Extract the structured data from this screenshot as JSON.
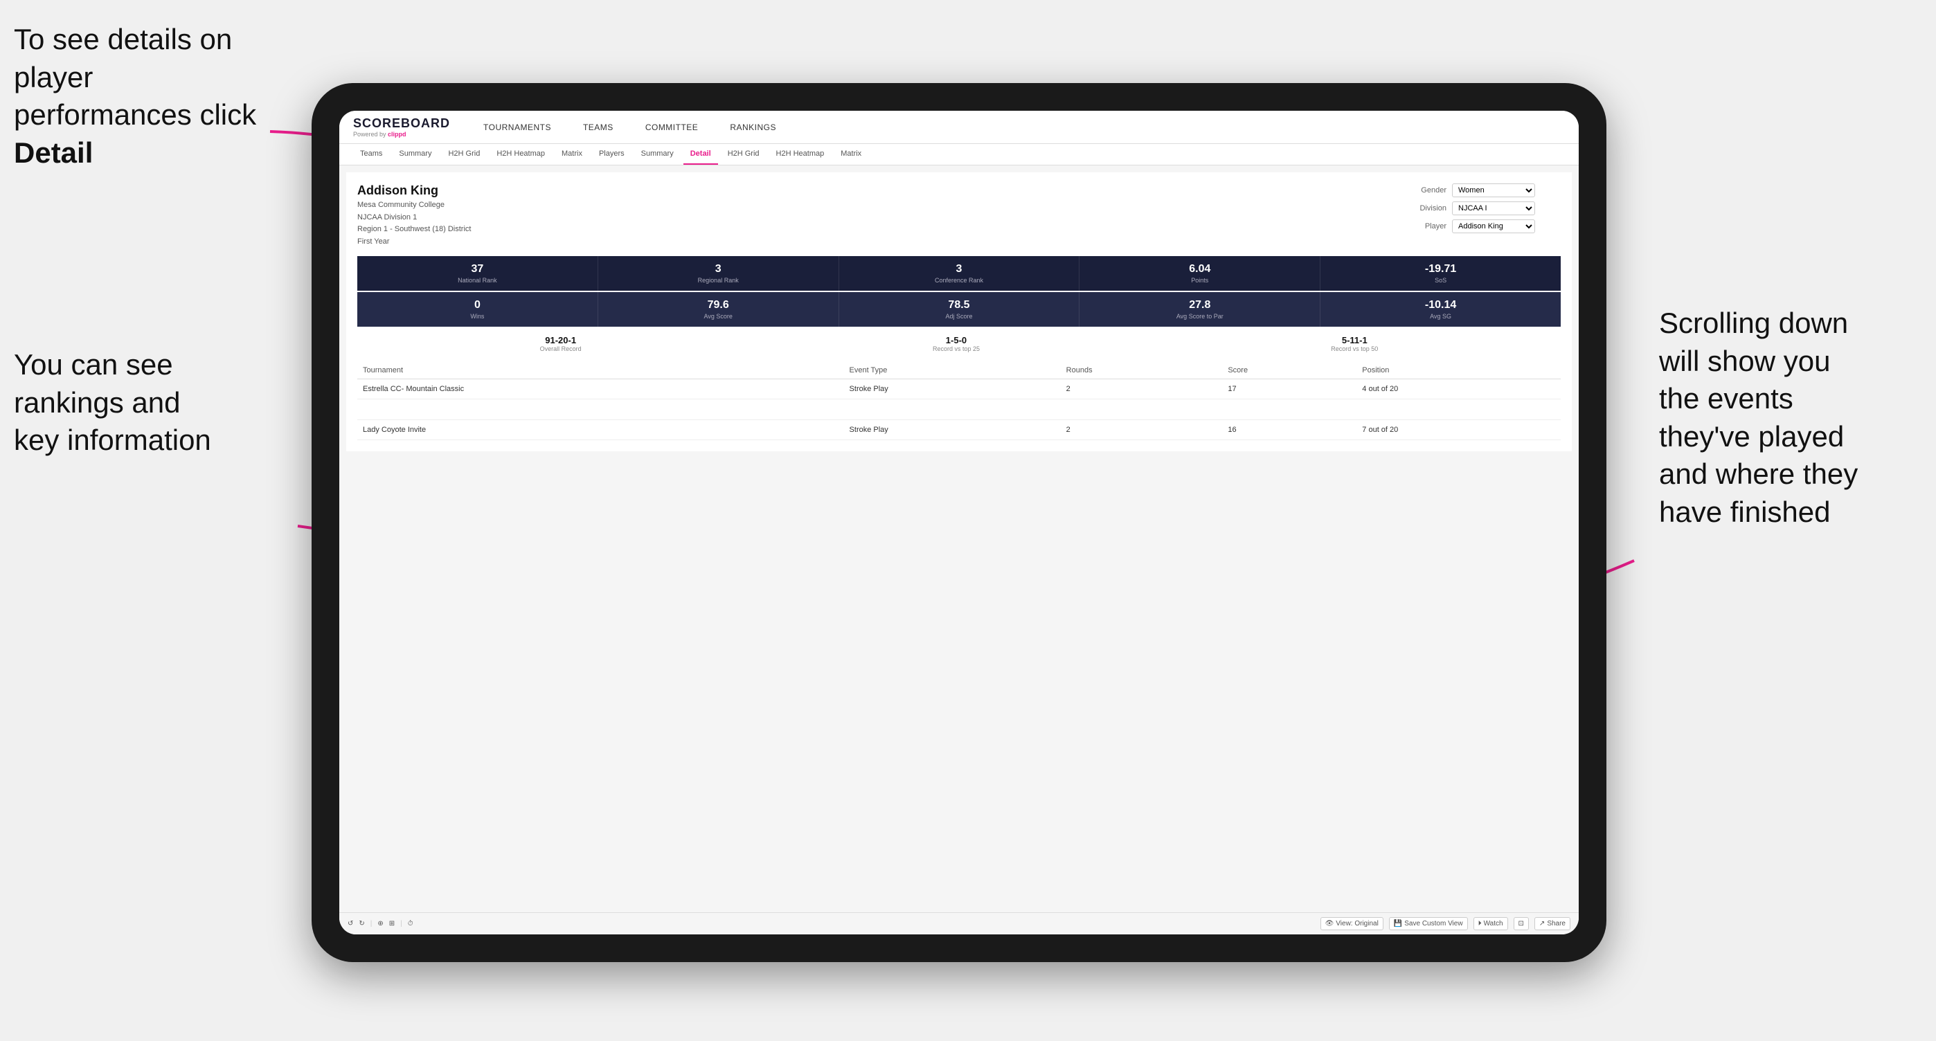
{
  "annotations": {
    "topleft": "To see details on player performances click ",
    "topleft_bold": "Detail",
    "bottomleft_line1": "You can see",
    "bottomleft_line2": "rankings and",
    "bottomleft_line3": "key information",
    "bottomright_line1": "Scrolling down",
    "bottomright_line2": "will show you",
    "bottomright_line3": "the events",
    "bottomright_line4": "they've played",
    "bottomright_line5": "and where they",
    "bottomright_line6": "have finished"
  },
  "nav": {
    "logo_main": "SCOREBOARD",
    "logo_sub": "Powered by",
    "logo_brand": "clippd",
    "items": [
      {
        "label": "TOURNAMENTS"
      },
      {
        "label": "TEAMS"
      },
      {
        "label": "COMMITTEE"
      },
      {
        "label": "RANKINGS"
      }
    ]
  },
  "sub_nav": {
    "items": [
      {
        "label": "Teams"
      },
      {
        "label": "Summary"
      },
      {
        "label": "H2H Grid"
      },
      {
        "label": "H2H Heatmap"
      },
      {
        "label": "Matrix"
      },
      {
        "label": "Players"
      },
      {
        "label": "Summary"
      },
      {
        "label": "Detail"
      },
      {
        "label": "H2H Grid"
      },
      {
        "label": "H2H Heatmap"
      },
      {
        "label": "Matrix"
      }
    ],
    "active_index": 7
  },
  "player": {
    "name": "Addison King",
    "school": "Mesa Community College",
    "division": "NJCAA Division 1",
    "region": "Region 1 - Southwest (18) District",
    "year": "First Year"
  },
  "filters": {
    "gender_label": "Gender",
    "gender_value": "Women",
    "division_label": "Division",
    "division_value": "NJCAA I",
    "player_label": "Player",
    "player_value": "Addison King"
  },
  "stats_row1": [
    {
      "value": "37",
      "label": "National Rank"
    },
    {
      "value": "3",
      "label": "Regional Rank"
    },
    {
      "value": "3",
      "label": "Conference Rank"
    },
    {
      "value": "6.04",
      "label": "Points"
    },
    {
      "value": "-19.71",
      "label": "SoS"
    }
  ],
  "stats_row2": [
    {
      "value": "0",
      "label": "Wins"
    },
    {
      "value": "79.6",
      "label": "Avg Score"
    },
    {
      "value": "78.5",
      "label": "Adj Score"
    },
    {
      "value": "27.8",
      "label": "Avg Score to Par"
    },
    {
      "value": "-10.14",
      "label": "Avg SG"
    }
  ],
  "records": [
    {
      "value": "91-20-1",
      "label": "Overall Record"
    },
    {
      "value": "1-5-0",
      "label": "Record vs top 25"
    },
    {
      "value": "5-11-1",
      "label": "Record vs top 50"
    }
  ],
  "table": {
    "headers": [
      "Tournament",
      "Event Type",
      "Rounds",
      "Score",
      "Position"
    ],
    "rows": [
      {
        "tournament": "Estrella CC- Mountain Classic",
        "event_type": "Stroke Play",
        "rounds": "2",
        "score": "17",
        "position": "4 out of 20"
      },
      {
        "tournament": "",
        "event_type": "",
        "rounds": "",
        "score": "",
        "position": ""
      },
      {
        "tournament": "Lady Coyote Invite",
        "event_type": "Stroke Play",
        "rounds": "2",
        "score": "16",
        "position": "7 out of 20"
      }
    ]
  },
  "toolbar": {
    "view_original": "View: Original",
    "save_custom": "Save Custom View",
    "watch": "Watch",
    "share": "Share"
  }
}
